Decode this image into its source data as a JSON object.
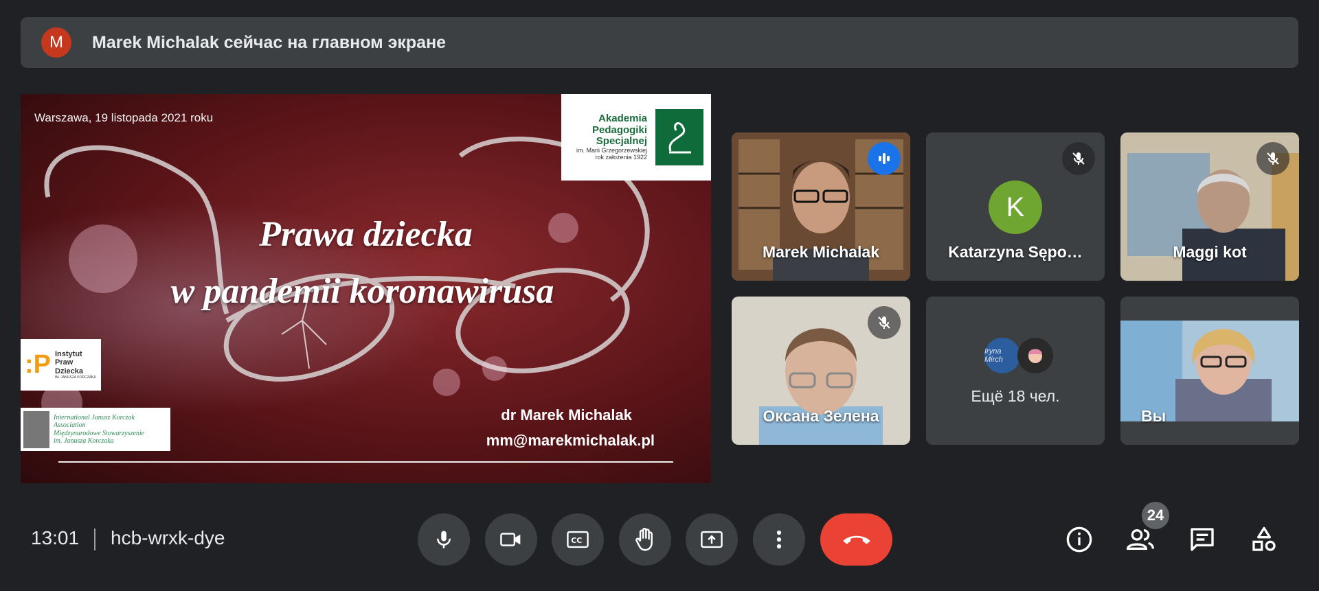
{
  "banner": {
    "avatar_letter": "M",
    "avatar_color": "#c5381e",
    "text": "Marek Michalak сейчас на главном экране"
  },
  "slide": {
    "date": "Warszawa, 19 listopada 2021 roku",
    "title_line1": "Prawa dziecka",
    "title_line2": "w pandemii koronawirusa",
    "author": "dr Marek Michalak",
    "email": "mm@marekmichalak.pl",
    "logo_aps": {
      "line1": "Akademia",
      "line2": "Pedagogiki",
      "line3": "Specjalnej",
      "line4": "im. Marii Grzegorzewskiej",
      "line5": "rok założenia 1922"
    },
    "logo_ipd": {
      "line1": "Instytut",
      "line2": "Praw",
      "line3": "Dziecka",
      "line4": "IM. JANUSZA KORCZAKA"
    },
    "logo_ijka": {
      "line1": "International Janusz Korczak",
      "line2": "Association",
      "line3": "Międzynarodowe Stowarzyszenie",
      "line4": "im. Janusza Korczaka"
    }
  },
  "participants": [
    {
      "name": "Marek Michalak",
      "state": "speaking"
    },
    {
      "name": "Katarzyna Sępo…",
      "state": "muted",
      "avatar_letter": "K",
      "avatar_color": "#6fa531"
    },
    {
      "name": "Maggi kot",
      "state": "muted"
    },
    {
      "name": "Оксана Зелена",
      "state": "muted"
    },
    {
      "name": "Ещё 18 чел.",
      "avatar_text": "Iryna Mirch"
    },
    {
      "name": "Вы"
    }
  ],
  "bottom": {
    "time": "13:01",
    "meeting_code": "hcb-wrxk-dye",
    "people_count": "24"
  },
  "icons": [
    "mic-icon",
    "camera-icon",
    "captions-icon",
    "raise-hand-icon",
    "present-icon",
    "more-options-icon",
    "hang-up-icon",
    "info-icon",
    "people-icon",
    "chat-icon",
    "activities-icon",
    "mic-off-icon",
    "audio-level-icon"
  ],
  "colors": {
    "background": "#202124",
    "surface": "#3c4043",
    "accent": "#8ab4f8",
    "hangup": "#ea4335",
    "speaking": "#1a73e8"
  }
}
